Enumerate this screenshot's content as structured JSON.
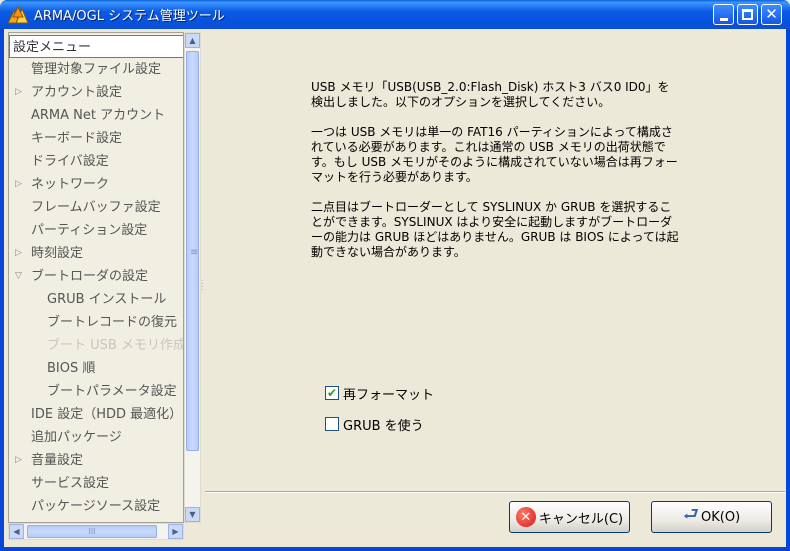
{
  "window": {
    "title": "ARMA/OGL システム管理ツール"
  },
  "menu": {
    "header": "設定メニュー",
    "items": [
      {
        "label": "管理対象ファイル設定",
        "expander": "",
        "indent": 1,
        "disabled": false
      },
      {
        "label": "アカウント設定",
        "expander": "▷",
        "indent": 1,
        "disabled": false
      },
      {
        "label": "ARMA Net アカウント",
        "expander": "",
        "indent": 1,
        "disabled": false
      },
      {
        "label": "キーボード設定",
        "expander": "",
        "indent": 1,
        "disabled": false
      },
      {
        "label": "ドライバ設定",
        "expander": "",
        "indent": 1,
        "disabled": false
      },
      {
        "label": "ネットワーク",
        "expander": "▷",
        "indent": 1,
        "disabled": false
      },
      {
        "label": "フレームバッファ設定",
        "expander": "",
        "indent": 1,
        "disabled": false
      },
      {
        "label": "パーティション設定",
        "expander": "",
        "indent": 1,
        "disabled": false
      },
      {
        "label": "時刻設定",
        "expander": "▷",
        "indent": 1,
        "disabled": false
      },
      {
        "label": "ブートローダの設定",
        "expander": "▽",
        "indent": 1,
        "disabled": false
      },
      {
        "label": "GRUB インストール",
        "expander": "",
        "indent": 2,
        "disabled": false
      },
      {
        "label": "ブートレコードの復元",
        "expander": "",
        "indent": 2,
        "disabled": false
      },
      {
        "label": "ブート USB メモリ作成",
        "expander": "",
        "indent": 2,
        "disabled": true
      },
      {
        "label": "BIOS 順",
        "expander": "",
        "indent": 2,
        "disabled": false
      },
      {
        "label": "ブートパラメータ設定",
        "expander": "",
        "indent": 2,
        "disabled": false
      },
      {
        "label": "IDE 設定（HDD 最適化）",
        "expander": "",
        "indent": 1,
        "disabled": false
      },
      {
        "label": "追加パッケージ",
        "expander": "",
        "indent": 1,
        "disabled": false
      },
      {
        "label": "音量設定",
        "expander": "▷",
        "indent": 1,
        "disabled": false
      },
      {
        "label": "サービス設定",
        "expander": "",
        "indent": 1,
        "disabled": false
      },
      {
        "label": "パッケージソース設定",
        "expander": "",
        "indent": 1,
        "disabled": false
      }
    ]
  },
  "content": {
    "paragraphs": [
      "USB メモリ「USB(USB_2.0:Flash_Disk) ホスト3 バス0 ID0」を検出しました。以下のオプションを選択してください。",
      "一つは USB メモリは単一の FAT16 パーティションによって構成されている必要があります。これは通常の USB メモリの出荷状態です。もし USB メモリがそのように構成されていない場合は再フォーマットを行う必要があります。",
      "二点目はブートローダーとして SYSLINUX か GRUB を選択することができます。SYSLINUX はより安全に起動しますがブートローダーの能力は GRUB ほどはありません。GRUB は BIOS によっては起動できない場合があります。"
    ],
    "options": [
      {
        "label": "再フォーマット",
        "checked": true
      },
      {
        "label": "GRUB を使う",
        "checked": false
      }
    ]
  },
  "buttons": {
    "cancel": "キャンセル(C)",
    "ok": "OK(O)"
  },
  "scroll": {
    "up": "▲",
    "down": "▼",
    "left": "◀",
    "right": "▶",
    "grip_v": "≡",
    "grip_h": "III"
  }
}
